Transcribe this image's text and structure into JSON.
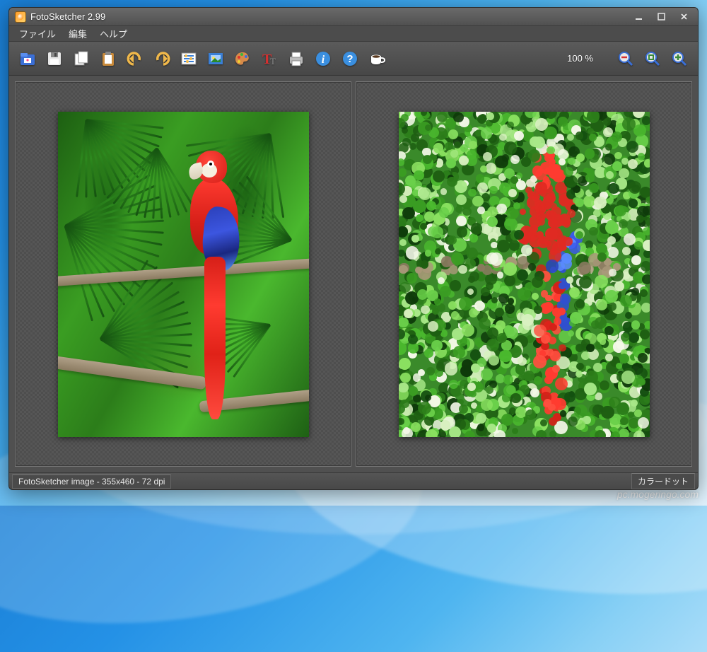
{
  "desktop": {
    "watermark": "pc.mogeringo.com"
  },
  "window": {
    "title": "FotoSketcher 2.99",
    "controls": {
      "minimize": "_",
      "maximize": "□",
      "close": "✕"
    }
  },
  "menu": {
    "file": "ファイル",
    "edit": "編集",
    "help": "ヘルプ"
  },
  "toolbar": {
    "icons": {
      "open": "open-icon",
      "save": "save-icon",
      "copy": "copy-icon",
      "paste": "paste-icon",
      "undo": "undo-icon",
      "redo": "redo-icon",
      "params": "params-icon",
      "frame": "frame-icon",
      "palette": "palette-icon",
      "text": "text-icon",
      "print": "print-icon",
      "info": "info-icon",
      "help": "help-icon",
      "coffee": "coffee-icon",
      "zoom_out": "zoom-out-icon",
      "zoom_fit": "zoom-fit-icon",
      "zoom_in": "zoom-in-icon"
    },
    "zoom": "100 %"
  },
  "status": {
    "left": "FotoSketcher image - 355x460 - 72 dpi",
    "right": "カラードット"
  }
}
